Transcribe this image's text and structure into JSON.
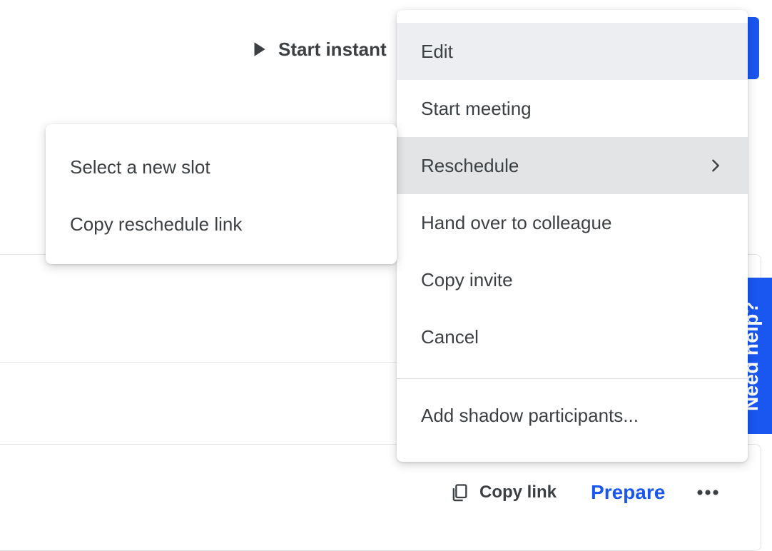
{
  "toolbar": {
    "start_instant_label": "Start instant"
  },
  "menu": {
    "items": [
      {
        "label": "Edit"
      },
      {
        "label": "Start meeting"
      },
      {
        "label": "Reschedule"
      },
      {
        "label": "Hand over to colleague"
      },
      {
        "label": "Copy invite"
      },
      {
        "label": "Cancel"
      }
    ],
    "shadow_label": "Add shadow participants..."
  },
  "submenu": {
    "items": [
      {
        "label": "Select a new slot"
      },
      {
        "label": "Copy reschedule link"
      }
    ]
  },
  "card": {
    "copy_link_label": "Copy link",
    "prepare_label": "Prepare"
  },
  "help": {
    "label": "Need help?"
  },
  "colors": {
    "accent": "#1a56f0",
    "menu_highlight": "#e3e4e6",
    "text": "#3c4043"
  },
  "icons": [
    "play-icon",
    "chevron-right-icon",
    "copy-icon",
    "more-horizontal-icon"
  ]
}
